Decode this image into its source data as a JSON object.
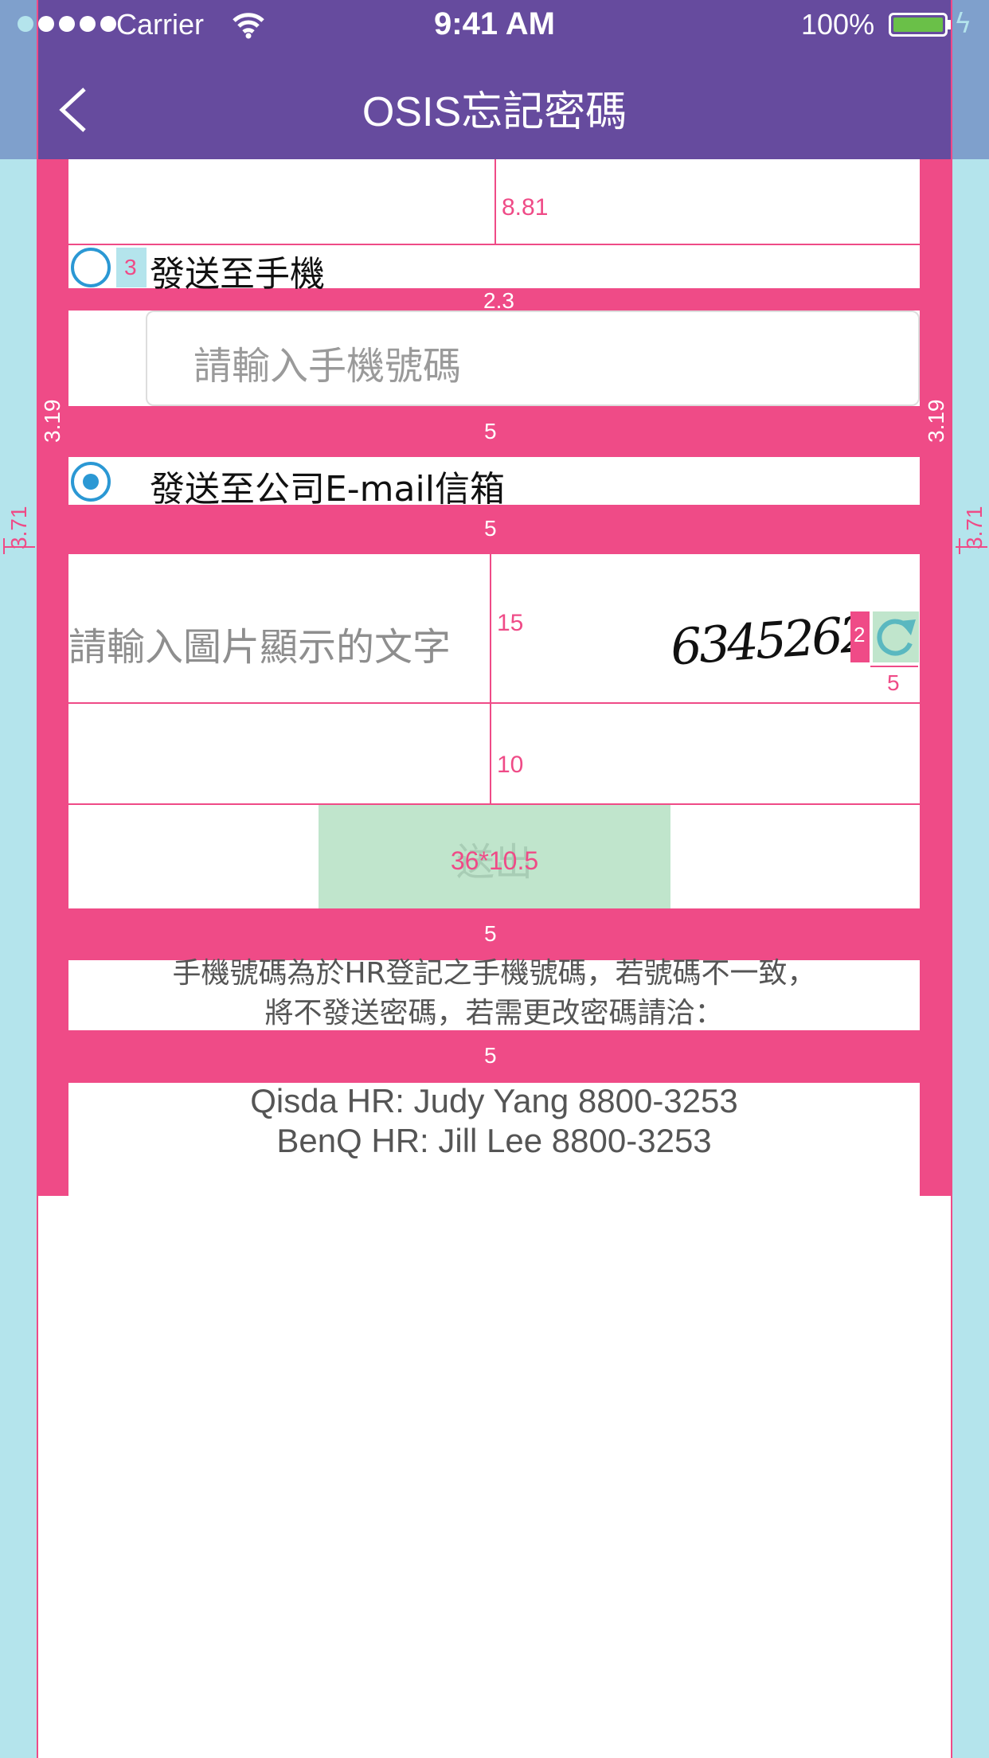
{
  "status_bar": {
    "carrier": "Carrier",
    "time": "9:41 AM",
    "battery_percent": "100%",
    "battery_level": 1.0,
    "signal_bars": 5
  },
  "nav": {
    "title": "OSIS忘記密碼",
    "back_icon": "chevron-left-icon"
  },
  "options": {
    "phone_label": "發送至手機",
    "phone_selected": false,
    "email_label": "發送至公司E-mail信箱",
    "email_selected": true
  },
  "phone_input": {
    "placeholder": "請輸入手機號碼",
    "value": ""
  },
  "captcha": {
    "placeholder": "請輸入圖片顯示的文字",
    "code": "6345262",
    "refresh_icon": "refresh-icon"
  },
  "submit": {
    "label": "送出"
  },
  "notice": {
    "line1": "手機號碼為於HR登記之手機號碼，若號碼不一致，",
    "line2": "將不發送密碼，若需更改密碼請洽："
  },
  "contacts": {
    "qisda": "Qisda HR: Judy Yang 8800-3253",
    "benq": "BenQ HR: Jill Lee 8800-3253"
  },
  "annotations": {
    "a_881": "8.81",
    "a_3": "3",
    "a_23": "2.3",
    "a_319": "3.19",
    "a_5_a": "5",
    "a_5_b": "5",
    "a_371": "3.71",
    "a_15": "15",
    "a_2": "2",
    "a_5_c": "5",
    "a_10": "10",
    "a_button": "36*10.5",
    "a_5_d": "5",
    "a_5_e": "5"
  },
  "colors": {
    "nav_bg": "#664b9e",
    "annotation_pink": "#ef4b87",
    "radio_blue": "#2b98d4",
    "side_cyan": "#b4e4ec",
    "button_green": "#c0e5cc"
  }
}
